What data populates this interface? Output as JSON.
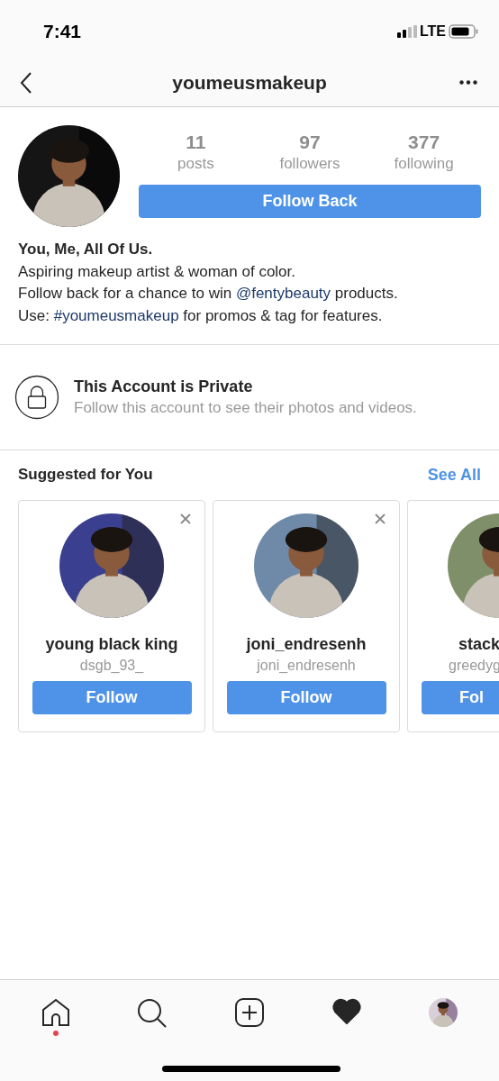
{
  "status_bar": {
    "time": "7:41",
    "network": "LTE"
  },
  "header": {
    "title": "youmeusmakeup"
  },
  "profile": {
    "stats": [
      {
        "value": "11",
        "label": "posts"
      },
      {
        "value": "97",
        "label": "followers"
      },
      {
        "value": "377",
        "label": "following"
      }
    ],
    "button": "Follow Back",
    "bio": {
      "name": "You, Me, All Of Us.",
      "lines": [
        [
          {
            "text": "Aspiring makeup artist & woman of color.",
            "kind": "plain"
          }
        ],
        [
          {
            "text": "Follow back for a chance to win ",
            "kind": "plain"
          },
          {
            "text": "@fentybeauty",
            "kind": "link"
          },
          {
            "text": " products.",
            "kind": "plain"
          }
        ],
        [
          {
            "text": "Use: ",
            "kind": "plain"
          },
          {
            "text": "#youmeusmakeup",
            "kind": "link"
          },
          {
            "text": " for promos & tag for features.",
            "kind": "plain"
          }
        ]
      ]
    }
  },
  "private": {
    "title": "This Account is Private",
    "subtitle": "Follow this account to see their photos and videos."
  },
  "suggested": {
    "title": "Suggested for You",
    "see_all": "See All",
    "cards": [
      {
        "name": "young black king",
        "handle": "dsgb_93_",
        "button": "Follow",
        "dismiss": true,
        "cut": false
      },
      {
        "name": "joni_endresenh",
        "handle": "joni_endresenh",
        "button": "Follow",
        "dismiss": true,
        "cut": false
      },
      {
        "name": "stack",
        "handle": "greedyg",
        "button": "Fol",
        "dismiss": false,
        "cut": true
      }
    ]
  },
  "tab_bar": [
    {
      "kind": "home",
      "selected": false,
      "badge": true
    },
    {
      "kind": "search",
      "selected": false,
      "badge": false
    },
    {
      "kind": "add",
      "selected": false,
      "badge": false
    },
    {
      "kind": "activity",
      "selected": true,
      "badge": false
    },
    {
      "kind": "profile",
      "selected": false,
      "badge": false
    }
  ]
}
